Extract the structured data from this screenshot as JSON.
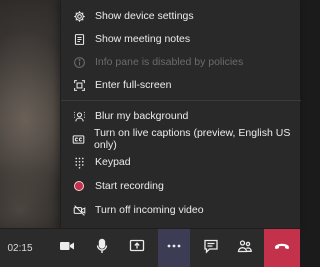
{
  "menu": {
    "items": [
      {
        "label": "Show device settings",
        "icon": "gear-icon",
        "enabled": true
      },
      {
        "label": "Show meeting notes",
        "icon": "notes-icon",
        "enabled": true
      },
      {
        "label": "Info pane is disabled by policies",
        "icon": "info-icon",
        "enabled": false
      },
      {
        "label": "Enter full-screen",
        "icon": "fullscreen-icon",
        "enabled": true
      },
      {
        "label": "Blur my background",
        "icon": "blur-background-icon",
        "enabled": true
      },
      {
        "label": "Turn on live captions (preview, English US only)",
        "icon": "captions-icon",
        "enabled": true
      },
      {
        "label": "Keypad",
        "icon": "keypad-icon",
        "enabled": true
      },
      {
        "label": "Start recording",
        "icon": "record-icon",
        "enabled": true
      },
      {
        "label": "Turn off incoming video",
        "icon": "video-off-icon",
        "enabled": true
      }
    ]
  },
  "toolbar": {
    "timer": "02:15",
    "buttons": [
      {
        "icon": "camera-icon"
      },
      {
        "icon": "microphone-icon"
      },
      {
        "icon": "share-screen-icon"
      },
      {
        "icon": "more-options-icon"
      },
      {
        "icon": "chat-icon"
      },
      {
        "icon": "participants-icon"
      },
      {
        "icon": "hang-up-icon"
      }
    ]
  },
  "colors": {
    "menu_bg": "#292929",
    "toolbar_bg": "#2b2b2b",
    "hangup": "#c4314b",
    "record": "#c4314b",
    "accent": "#6264a7"
  }
}
